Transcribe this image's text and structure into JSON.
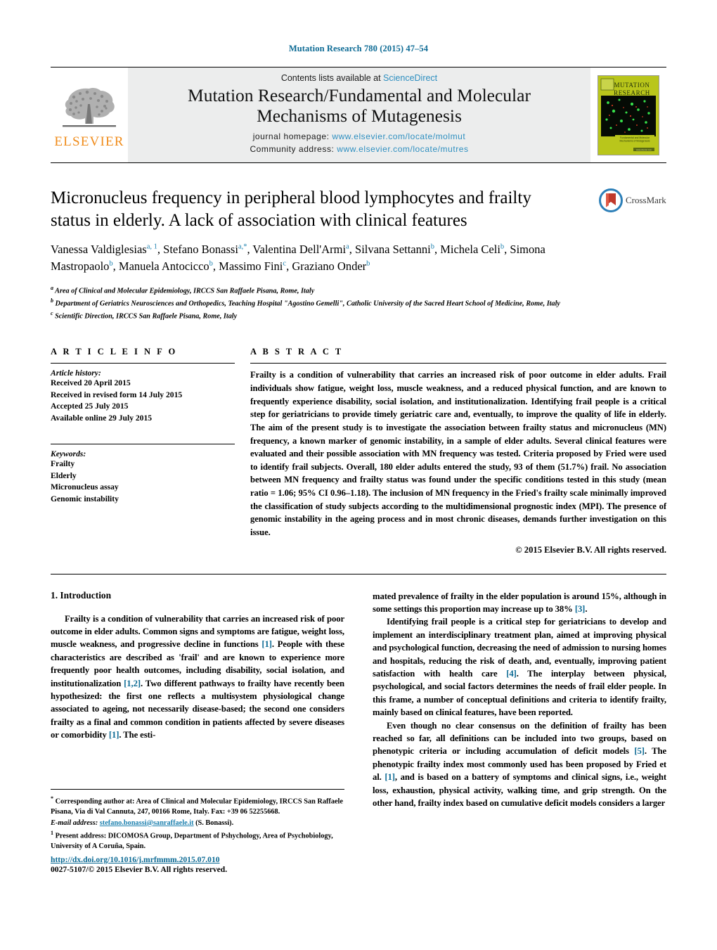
{
  "running_head": "Mutation Research 780 (2015) 47–54",
  "masthead": {
    "publisher_logo_text": "ELSEVIER",
    "contents_prefix": "Contents lists available at ",
    "contents_link": "ScienceDirect",
    "journal_title_line1": "Mutation Research/Fundamental and Molecular",
    "journal_title_line2": "Mechanisms of Mutagenesis",
    "homepage_label": "journal homepage:",
    "homepage_url": "www.elsevier.com/locate/molmut",
    "community_label": "Community address:",
    "community_url": "www.elsevier.com/locate/mutres",
    "cover_title_line1": "MUTATION",
    "cover_title_line2": "RESEARCH",
    "cover_subtitle": "Fundamental and Molecular Mechanisms of Mutagenesis",
    "cover_footer": "www.elsevier.com"
  },
  "article": {
    "title": "Micronucleus frequency in peripheral blood lymphocytes and frailty status in elderly. A lack of association with clinical features",
    "authors_html": "Vanessa Valdiglesias<sup>a, 1</sup>, Stefano Bonassi<sup>a,*</sup>, Valentina Dell'Armi<sup>a</sup>, Silvana Settanni<sup>b</sup>, Michela Celi<sup>b</sup>, Simona Mastropaolo<sup>b</sup>, Manuela Antocicco<sup>b</sup>, Massimo Fini<sup>c</sup>, Graziano Onder<sup>b</sup>",
    "affiliations": [
      {
        "marker": "a",
        "text": "Area of Clinical and Molecular Epidemiology, IRCCS San Raffaele Pisana, Rome, Italy"
      },
      {
        "marker": "b",
        "text": "Department of Geriatrics Neurosciences and Orthopedics, Teaching Hospital \"Agostino Gemelli\", Catholic University of the Sacred Heart School of Medicine, Rome, Italy"
      },
      {
        "marker": "c",
        "text": "Scientific Direction, IRCCS San Raffaele Pisana, Rome, Italy"
      }
    ],
    "crossmark_label": "CrossMark"
  },
  "article_info": {
    "heading": "A R T I C L E   I N F O",
    "history_label": "Article history:",
    "history": [
      "Received 20 April 2015",
      "Received in revised form 14 July 2015",
      "Accepted 25 July 2015",
      "Available online 29 July 2015"
    ],
    "keywords_label": "Keywords:",
    "keywords": [
      "Frailty",
      "Elderly",
      "Micronucleus assay",
      "Genomic instability"
    ]
  },
  "abstract": {
    "heading": "A B S T R A C T",
    "text": "Frailty is a condition of vulnerability that carries an increased risk of poor outcome in elder adults. Frail individuals show fatigue, weight loss, muscle weakness, and a reduced physical function, and are known to frequently experience disability, social isolation, and institutionalization. Identifying frail people is a critical step for geriatricians to provide timely geriatric care and, eventually, to improve the quality of life in elderly. The aim of the present study is to investigate the association between frailty status and micronucleus (MN) frequency, a known marker of genomic instability, in a sample of elder adults. Several clinical features were evaluated and their possible association with MN frequency was tested. Criteria proposed by Fried were used to identify frail subjects. Overall, 180 elder adults entered the study, 93 of them (51.7%) frail. No association between MN frequency and frailty status was found under the specific conditions tested in this study (mean ratio = 1.06; 95% CI 0.96–1.18). The inclusion of MN frequency in the Fried's frailty scale minimally improved the classification of study subjects according to the multidimensional prognostic index (MPI). The presence of genomic instability in the ageing process and in most chronic diseases, demands further investigation on this issue.",
    "copyright": "© 2015 Elsevier B.V. All rights reserved."
  },
  "body": {
    "section_number_title": "1.  Introduction",
    "left_paragraphs_html": [
      "Frailty is a condition of vulnerability that carries an increased risk of poor outcome in elder adults. Common signs and symptoms are fatigue, weight loss, muscle weakness, and progressive decline in functions <span class=\"ref\">[1]</span>. People with these characteristics are described as 'frail' and are known to experience more frequently poor health outcomes, including disability, social isolation, and institutionalization <span class=\"ref\">[1,2]</span>. Two different pathways to frailty have recently been hypothesized: the first one reflects a multisystem physiological change associated to ageing, not necessarily disease-based; the second one considers frailty as a final and common condition in patients affected by severe diseases or comorbidity <span class=\"ref\">[1]</span>. The esti-"
    ],
    "right_paragraphs_html": [
      "mated prevalence of frailty in the elder population is around 15%, although in some settings this proportion may increase up to 38% <span class=\"ref\">[3]</span>.",
      "Identifying frail people is a critical step for geriatricians to develop and implement an interdisciplinary treatment plan, aimed at improving physical and psychological function, decreasing the need of admission to nursing homes and hospitals, reducing the risk of death, and, eventually, improving patient satisfaction with health care <span class=\"ref\">[4]</span>. The interplay between physical, psychological, and social factors determines the needs of frail elder people. In this frame, a number of conceptual definitions and criteria to identify frailty, mainly based on clinical features, have been reported.",
      "Even though no clear consensus on the definition of frailty has been reached so far, all definitions can be included into two groups, based on phenotypic criteria or including accumulation of deficit models <span class=\"ref\">[5]</span>. The phenotypic frailty index most commonly used has been proposed by Fried et al. <span class=\"ref\">[1]</span>, and is based on a battery of symptoms and clinical signs, i.e., weight loss, exhaustion, physical activity, walking time, and grip strength. On the other hand, frailty index based on cumulative deficit models considers a larger"
    ]
  },
  "footnotes": {
    "corresponding_html": "<sup>*</sup> Corresponding author at: Area of Clinical and Molecular Epidemiology, IRCCS San Raffaele Pisana, Via di Val Cannuta, 247, 00166 Rome, Italy. Fax: +39 06 52255668.",
    "email_label": "E-mail address:",
    "email_address": "stefano.bonassi@sanraffaele.it",
    "email_suffix": "(S. Bonassi).",
    "present_address_html": "<sup>1</sup> Present address: DICOMOSA Group, Department of Pshychology, Area of Psychobiology, University of A Coruña, Spain."
  },
  "footer": {
    "doi": "http://dx.doi.org/10.1016/j.mrfmmm.2015.07.010",
    "issn_line": "0027-5107/© 2015 Elsevier B.V. All rights reserved."
  },
  "colors": {
    "link_blue": "#2e8fc0",
    "ref_blue": "#0c6a94",
    "elsevier_orange": "#f08c1b",
    "masthead_grey": "#eceded"
  }
}
